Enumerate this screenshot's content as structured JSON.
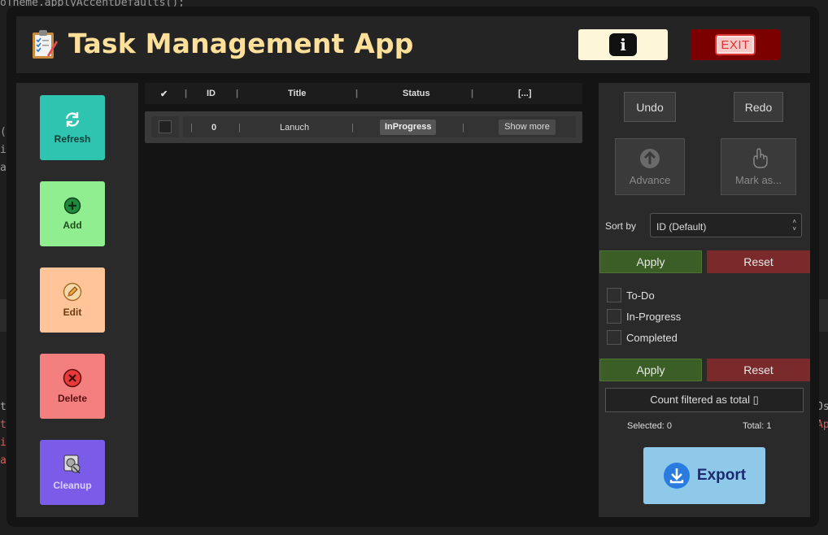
{
  "background": {
    "code_top": "oTheme.applyAccentDefaults();",
    "code_left": [
      "(",
      "ir",
      "an"
    ],
    "code_left2": [
      "ts",
      "",
      "ti",
      "i",
      "ac"
    ],
    "code_right": [
      "Os",
      "",
      "Ap"
    ]
  },
  "header": {
    "title": "Task Management App",
    "info_label": "i",
    "exit_label": "EXIT"
  },
  "sidebar": {
    "items": [
      {
        "label": "Refresh",
        "color": "#2ec4b0",
        "text_color": "#0e3b35"
      },
      {
        "label": "Add",
        "color": "#90ee90",
        "text_color": "#1d4d1d"
      },
      {
        "label": "Edit",
        "color": "#ffc599",
        "text_color": "#6b3a10"
      },
      {
        "label": "Delete",
        "color": "#f47f7f",
        "text_color": "#5b1010"
      },
      {
        "label": "Cleanup",
        "color": "#7b5ce8",
        "text_color": "#dcd2ff"
      }
    ]
  },
  "table": {
    "headers": {
      "check": "✔",
      "id": "ID",
      "title": "Title",
      "status": "Status",
      "more": "[...]"
    },
    "rows": [
      {
        "id": "0",
        "title": "Lanuch",
        "status": "InProgress",
        "action": "Show more"
      }
    ]
  },
  "right_panel": {
    "undo": "Undo",
    "redo": "Redo",
    "advance": "Advance",
    "mark_as": "Mark as...",
    "sort_label": "Sort by",
    "sort_value": "ID (Default)",
    "apply": "Apply",
    "reset": "Reset",
    "filters": [
      "To-Do",
      "In-Progress",
      "Completed"
    ],
    "count_label": "Count filtered as total ▯",
    "selected": "Selected: 0",
    "total": "Total: 1",
    "export": "Export"
  }
}
